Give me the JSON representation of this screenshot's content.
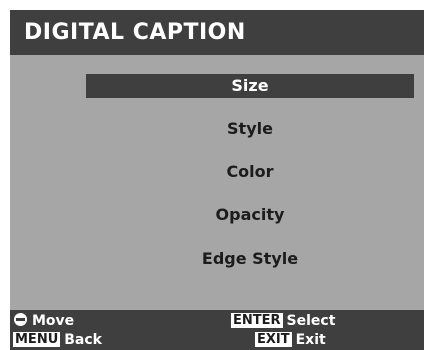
{
  "header": {
    "title": "DIGITAL CAPTION"
  },
  "menu": {
    "items": [
      {
        "label": "Size",
        "selected": true
      },
      {
        "label": "Style",
        "selected": false
      },
      {
        "label": "Color",
        "selected": false
      },
      {
        "label": "Opacity",
        "selected": false
      },
      {
        "label": "Edge Style",
        "selected": false
      }
    ]
  },
  "footer": {
    "move_icon": "move-icon",
    "move_label": "Move",
    "enter_key": "ENTER",
    "select_label": "Select",
    "menu_key": "MENU",
    "back_label": "Back",
    "exit_key": "EXIT",
    "exit_label": "Exit"
  },
  "colors": {
    "bar": "#3f3f3f",
    "panel": "#a6a6a6",
    "text_dark": "#1c1c1c",
    "text_light": "#ffffff"
  }
}
